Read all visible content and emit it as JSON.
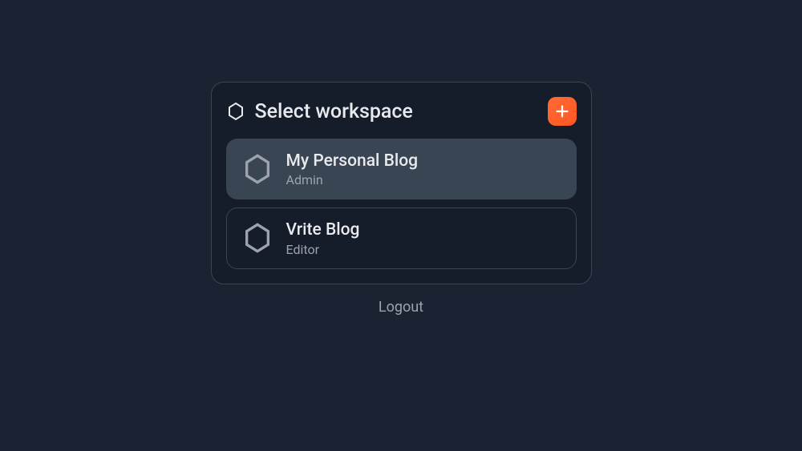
{
  "header": {
    "title": "Select workspace"
  },
  "workspaces": [
    {
      "name": "My Personal Blog",
      "role": "Admin"
    },
    {
      "name": "Vrite Blog",
      "role": "Editor"
    }
  ],
  "footer": {
    "logout": "Logout"
  }
}
